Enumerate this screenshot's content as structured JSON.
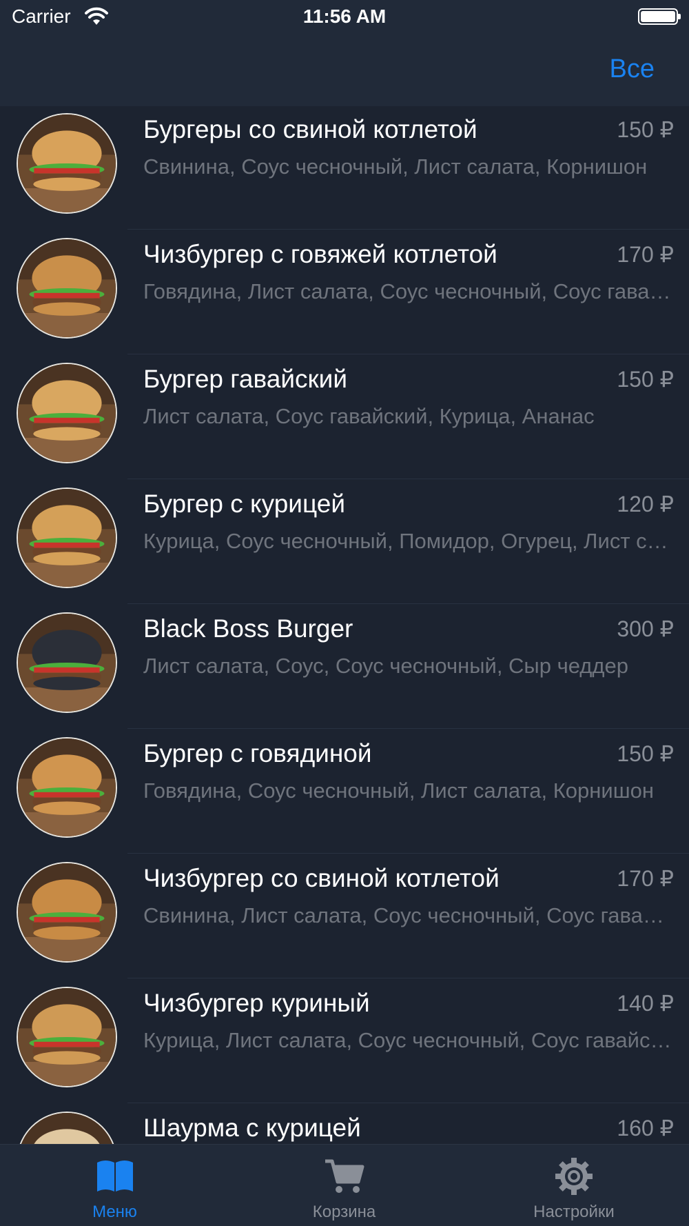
{
  "status_bar": {
    "carrier": "Carrier",
    "time": "11:56 AM"
  },
  "nav": {
    "right_button": "Все"
  },
  "menu_items": [
    {
      "name": "Бургеры со свиной котлетой",
      "price": "150 ₽",
      "description": "Свинина, Соус чесночный, Лист салата, Корнишон"
    },
    {
      "name": "Чизбургер с говяжей котлетой",
      "price": "170 ₽",
      "description": "Говядина, Лист салата, Соус чесночный, Соус гавайский"
    },
    {
      "name": "Бургер гавайский",
      "price": "150 ₽",
      "description": "Лист салата, Соус гавайский, Курица, Ананас"
    },
    {
      "name": "Бургер с курицей",
      "price": "120 ₽",
      "description": "Курица, Соус чесночный, Помидор, Огурец, Лист салата"
    },
    {
      "name": "Black Boss Burger",
      "price": "300 ₽",
      "description": "Лист салата, Соус, Соус чесночный, Сыр чеддер"
    },
    {
      "name": "Бургер с говядиной",
      "price": "150 ₽",
      "description": "Говядина, Соус чесночный, Лист салата, Корнишон"
    },
    {
      "name": "Чизбургер со свиной котлетой",
      "price": "170 ₽",
      "description": "Свинина, Лист салата, Соус чесночный, Соус гавайский"
    },
    {
      "name": "Чизбургер куриный",
      "price": "140 ₽",
      "description": "Курица, Лист салата, Соус чесночный, Соус гавайский"
    },
    {
      "name": "Шаурма с курицей",
      "price": "160 ₽",
      "description": ""
    }
  ],
  "tabs": [
    {
      "label": "Меню",
      "icon": "book-icon",
      "active": true
    },
    {
      "label": "Корзина",
      "icon": "cart-icon",
      "active": false
    },
    {
      "label": "Настройки",
      "icon": "gear-icon",
      "active": false
    }
  ],
  "colors": {
    "accent": "#1a82f0",
    "background": "#1c2330",
    "bar": "#212a39",
    "inactive": "#8a8f98"
  }
}
